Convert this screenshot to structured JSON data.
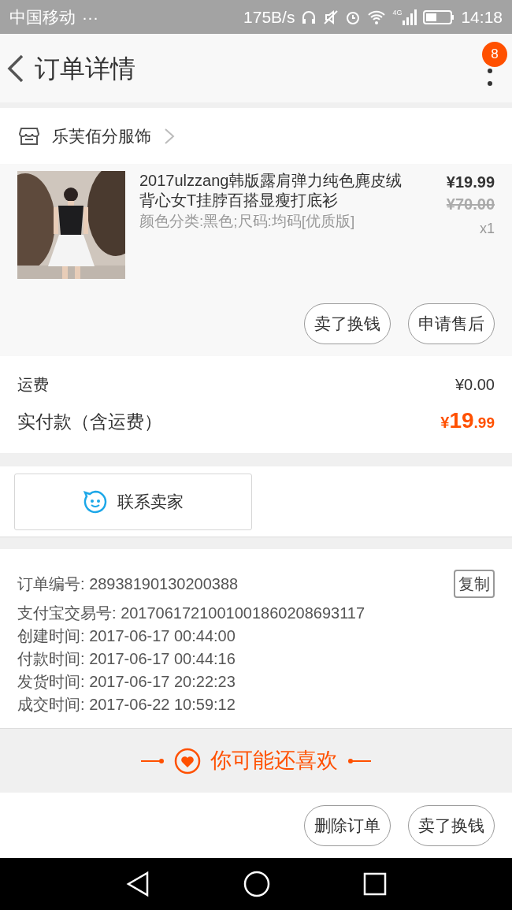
{
  "status_bar": {
    "carrier": "中国移动",
    "more": "···",
    "speed": "175B/s",
    "network": "4G",
    "time": "14:18"
  },
  "header": {
    "title": "订单详情",
    "badge": "8"
  },
  "store": {
    "name": "乐芙佰分服饰"
  },
  "product": {
    "title": "2017ulzzang韩版露肩弹力纯色麂皮绒背心女T挂脖百搭显瘦打底衫",
    "sku": "颜色分类:黑色;尺码:均码[优质版]",
    "price": "¥19.99",
    "original_price": "¥70.00",
    "quantity": "x1",
    "actions": [
      "卖了换钱",
      "申请售后"
    ]
  },
  "fees": {
    "shipping_label": "运费",
    "shipping_value": "¥0.00",
    "paid_label": "实付款（含运费）",
    "paid_symbol": "¥",
    "paid_integer": "19",
    "paid_decimal": ".99"
  },
  "contact": {
    "label": "联系卖家"
  },
  "order_info": {
    "copy": "复制",
    "lines": [
      {
        "label": "订单编号:",
        "value": "28938190130200388"
      },
      {
        "label": "支付宝交易号:",
        "value": "2017061721001001860208693117"
      },
      {
        "label": "创建时间:",
        "value": "2017-06-17 00:44:00"
      },
      {
        "label": "付款时间:",
        "value": "2017-06-17 00:44:16"
      },
      {
        "label": "发货时间:",
        "value": "2017-06-17 20:22:23"
      },
      {
        "label": "成交时间:",
        "value": "2017-06-22 10:59:12"
      }
    ]
  },
  "recommend": {
    "title": "你可能还喜欢"
  },
  "bottom_actions": [
    "删除订单",
    "卖了换钱"
  ]
}
